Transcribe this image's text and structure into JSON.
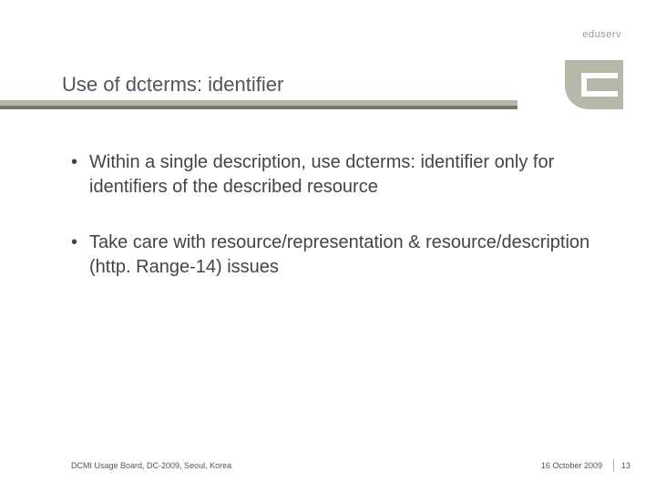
{
  "brand": "eduserv",
  "title": "Use of dcterms: identifier",
  "bullets": [
    "Within a single description, use dcterms: identifier only for identifiers of the described resource",
    "Take care with resource/representation & resource/description (http. Range-14) issues"
  ],
  "footer": {
    "left": "DCMI Usage Board, DC-2009, Seoul, Korea",
    "date": "16 October 2009",
    "page": "13"
  }
}
